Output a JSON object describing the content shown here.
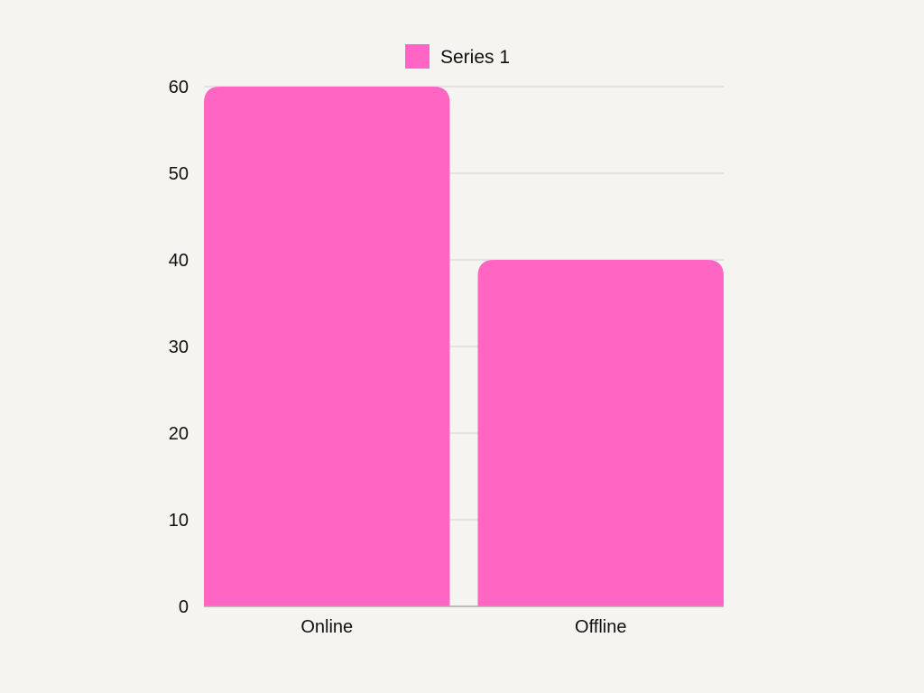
{
  "chart_data": {
    "type": "bar",
    "categories": [
      "Online",
      "Offline"
    ],
    "series": [
      {
        "name": "Series 1",
        "values": [
          60,
          40
        ]
      }
    ],
    "ylim": [
      0,
      60
    ],
    "yticks": [
      0,
      10,
      20,
      30,
      40,
      50,
      60
    ],
    "grid": true,
    "legend": "top-center",
    "title": "",
    "xlabel": "",
    "ylabel": ""
  },
  "colors": {
    "background": "#f6f4f1",
    "bar": "#ff66c4",
    "grid": "#d6d6d6",
    "axis": "#a9a9a9",
    "text": "#111111"
  }
}
